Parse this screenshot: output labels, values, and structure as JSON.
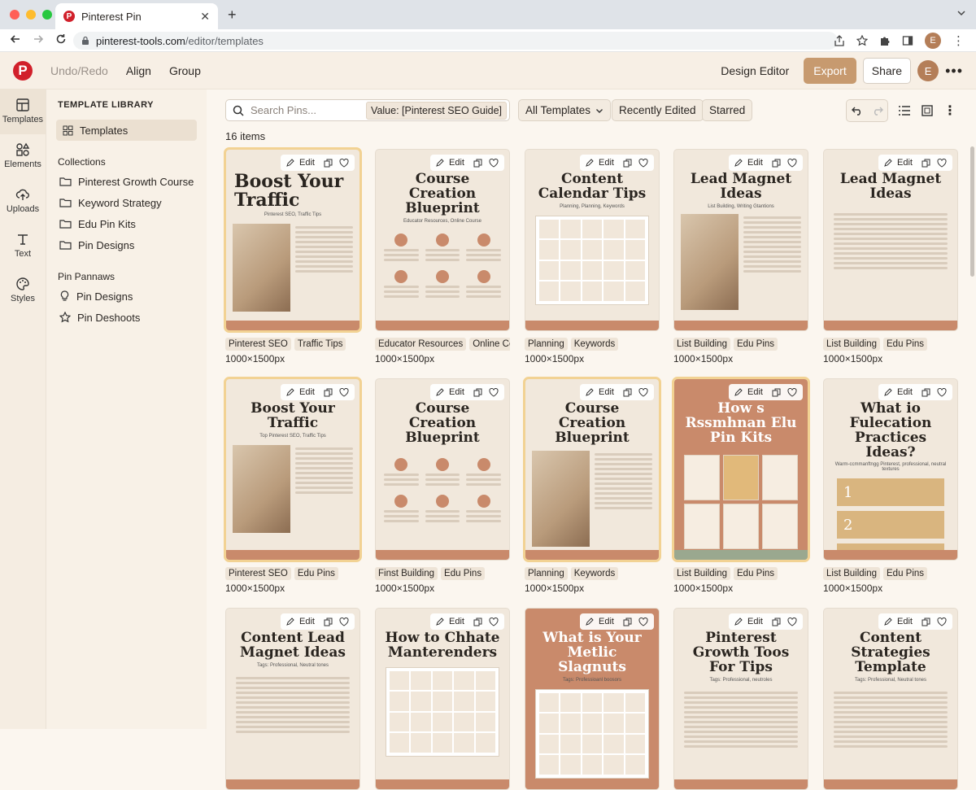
{
  "browser": {
    "tab_title": "Pinterest Pin",
    "url_host": "pinterest-tools.com",
    "url_path": "/editor/templates",
    "profile_initial": "E"
  },
  "header": {
    "menu": [
      "Undo/Redo",
      "Align",
      "Group"
    ],
    "title": "Design Editor",
    "export_label": "Export",
    "share_label": "Share",
    "avatar_initial": "E"
  },
  "rail": [
    {
      "label": "Templates",
      "icon": "templates-icon"
    },
    {
      "label": "Elements",
      "icon": "elements-icon"
    },
    {
      "label": "Uploads",
      "icon": "uploads-icon"
    },
    {
      "label": "Text",
      "icon": "text-icon"
    },
    {
      "label": "Styles",
      "icon": "styles-icon"
    }
  ],
  "sidebar": {
    "heading": "TEMPLATE LIBRARY",
    "selected": "Templates",
    "collections_label": "Collections",
    "collections": [
      "Pinterest Growth Course",
      "Keyword Strategy",
      "Edu Pin Kits",
      "Pin Designs"
    ],
    "pin_label": "Pin Pannaws",
    "pins": [
      "Pin Designs",
      "Pin Deshoots"
    ]
  },
  "toolbar": {
    "search_placeholder": "Search Pins...",
    "search_value": "Value: [Pinterest SEO Guide]",
    "filter": "All Templates",
    "recent": "Recently Edited",
    "starred": "Starred",
    "count": "16 items"
  },
  "card_edit_label": "Edit",
  "colors": {
    "accent": "#c79a6f",
    "brand": "#d1202b",
    "highlight": "#f2d293"
  },
  "cards": [
    {
      "title": "Boost Your Traffic",
      "subtitle": "Pinterest SEO, Traffic Tips",
      "tags": [
        "Pinterest SEO",
        "Traffic Tips"
      ],
      "size": "1000×1500px"
    },
    {
      "title": "Course Creation Blueprint",
      "subtitle": "Educator Resources, Online Course",
      "tags": [
        "Educator Resources",
        "Online Cour"
      ],
      "size": "1000×1500px"
    },
    {
      "title": "Content Calendar Tips",
      "subtitle": "Planning, Planning, Keywords",
      "tags": [
        "Planning",
        "Keywords"
      ],
      "size": "1000×1500px"
    },
    {
      "title": "Lead Magnet Ideas",
      "subtitle": "List Building, Writing Gtantions",
      "tags": [
        "List Building",
        "Edu Pins"
      ],
      "size": "1000×1500px"
    },
    {
      "title": "Lead Magnet Ideas",
      "subtitle": "",
      "tags": [
        "List Building",
        "Edu Pins"
      ],
      "size": "1000×1500px"
    },
    {
      "title": "Boost Your Traffic",
      "subtitle": "Top Pinterest SEO, Traffic Tips",
      "tags": [
        "Pinterest SEO",
        "Edu Pins"
      ],
      "size": "1000×1500px"
    },
    {
      "title": "Course Creation Blueprint",
      "subtitle": "",
      "tags": [
        "Finst Building",
        "Edu Pins"
      ],
      "size": "1000×1500px"
    },
    {
      "title": "Course Creation Blueprint",
      "subtitle": "",
      "tags": [
        "Planning",
        "Keywords"
      ],
      "size": "1000×1500px"
    },
    {
      "title": "How s Rssmhnan Elu Pin Kits",
      "subtitle": "",
      "tags": [
        "List Building",
        "Edu Pins"
      ],
      "size": "1000×1500px"
    },
    {
      "title": "What io Fulecation Practices Ideas?",
      "subtitle": "Warm-ccmmanftngg Pinterest, professional, neutral textures",
      "tags": [
        "List Building",
        "Edu Pins"
      ],
      "size": "1000×1500px"
    },
    {
      "title": "Content Lead Magnet Ideas",
      "subtitle": "Tags: Professional, Neutral tones",
      "tags": [],
      "size": ""
    },
    {
      "title": "How to Chhate Manterenders",
      "subtitle": "",
      "tags": [],
      "size": ""
    },
    {
      "title": "What is Your Metlic Slagnuts",
      "subtitle": "Tags: Professioanl boosors",
      "tags": [],
      "size": ""
    },
    {
      "title": "Pinterest Growth Toos For Tips",
      "subtitle": "Tags: Professional, neutroles",
      "tags": [],
      "size": ""
    },
    {
      "title": "Content Strategies Template",
      "subtitle": "Tags: Professional, Neutral tones",
      "tags": [],
      "size": ""
    }
  ]
}
